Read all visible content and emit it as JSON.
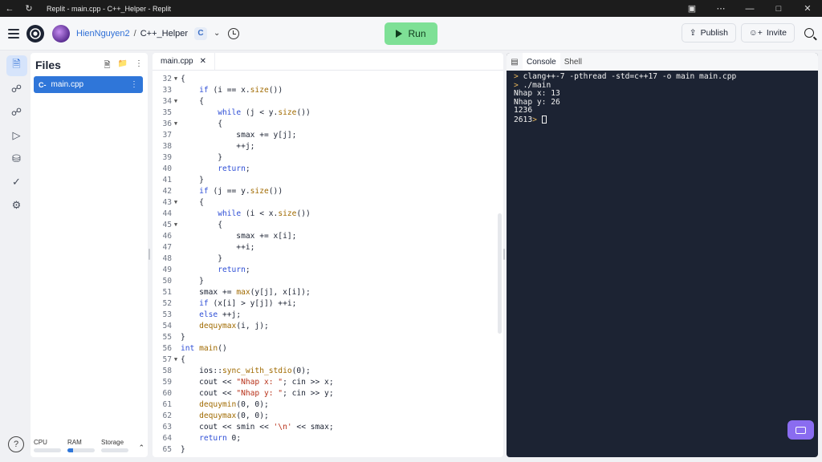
{
  "window": {
    "title": "Replit - main.cpp - C++_Helper - Replit"
  },
  "header": {
    "username": "HienNguyen2",
    "separator": "/",
    "repl_name": "C++_Helper",
    "lang_badge": "C",
    "run_label": "Run",
    "publish_label": "Publish",
    "invite_label": "Invite"
  },
  "files": {
    "title": "Files",
    "items": [
      {
        "label": "main.cpp",
        "icon_text": "C-"
      }
    ]
  },
  "resources": {
    "cpu": {
      "label": "CPU",
      "level": 0.0
    },
    "ram": {
      "label": "RAM",
      "level": 0.22
    },
    "storage": {
      "label": "Storage",
      "level": 0.0
    }
  },
  "editor": {
    "tab_label": "main.cpp",
    "lines": [
      {
        "n": "32",
        "fold": true,
        "t": [
          [
            "{",
            ""
          ]
        ]
      },
      {
        "n": "33",
        "fold": false,
        "t": [
          [
            "    ",
            ""
          ],
          [
            "if",
            "kw"
          ],
          [
            " (i == x.",
            ""
          ],
          [
            "size",
            "fnc"
          ],
          [
            "())",
            ""
          ]
        ]
      },
      {
        "n": "34",
        "fold": true,
        "t": [
          [
            "    {",
            ""
          ]
        ]
      },
      {
        "n": "35",
        "fold": false,
        "t": [
          [
            "        ",
            ""
          ],
          [
            "while",
            "kw"
          ],
          [
            " (j < y.",
            ""
          ],
          [
            "size",
            "fnc"
          ],
          [
            "())",
            ""
          ]
        ]
      },
      {
        "n": "36",
        "fold": true,
        "t": [
          [
            "        {",
            ""
          ]
        ]
      },
      {
        "n": "37",
        "fold": false,
        "t": [
          [
            "            smax += y[j];",
            ""
          ]
        ]
      },
      {
        "n": "38",
        "fold": false,
        "t": [
          [
            "            ++j;",
            ""
          ]
        ]
      },
      {
        "n": "39",
        "fold": false,
        "t": [
          [
            "        }",
            ""
          ]
        ]
      },
      {
        "n": "40",
        "fold": false,
        "t": [
          [
            "        ",
            ""
          ],
          [
            "return",
            "kw"
          ],
          [
            ";",
            ""
          ]
        ]
      },
      {
        "n": "41",
        "fold": false,
        "t": [
          [
            "    }",
            ""
          ]
        ]
      },
      {
        "n": "42",
        "fold": false,
        "t": [
          [
            "    ",
            ""
          ],
          [
            "if",
            "kw"
          ],
          [
            " (j == y.",
            ""
          ],
          [
            "size",
            "fnc"
          ],
          [
            "())",
            ""
          ]
        ]
      },
      {
        "n": "43",
        "fold": true,
        "t": [
          [
            "    {",
            ""
          ]
        ]
      },
      {
        "n": "44",
        "fold": false,
        "t": [
          [
            "        ",
            ""
          ],
          [
            "while",
            "kw"
          ],
          [
            " (i < x.",
            ""
          ],
          [
            "size",
            "fnc"
          ],
          [
            "())",
            ""
          ]
        ]
      },
      {
        "n": "45",
        "fold": true,
        "t": [
          [
            "        {",
            ""
          ]
        ]
      },
      {
        "n": "46",
        "fold": false,
        "t": [
          [
            "            smax += x[i];",
            ""
          ]
        ]
      },
      {
        "n": "47",
        "fold": false,
        "t": [
          [
            "            ++i;",
            ""
          ]
        ]
      },
      {
        "n": "48",
        "fold": false,
        "t": [
          [
            "        }",
            ""
          ]
        ]
      },
      {
        "n": "49",
        "fold": false,
        "t": [
          [
            "        ",
            ""
          ],
          [
            "return",
            "kw"
          ],
          [
            ";",
            ""
          ]
        ]
      },
      {
        "n": "50",
        "fold": false,
        "t": [
          [
            "    }",
            ""
          ]
        ]
      },
      {
        "n": "51",
        "fold": false,
        "t": [
          [
            "    smax += ",
            ""
          ],
          [
            "max",
            "fnc"
          ],
          [
            "(y[j], x[i]);",
            ""
          ]
        ]
      },
      {
        "n": "52",
        "fold": false,
        "t": [
          [
            "    ",
            ""
          ],
          [
            "if",
            "kw"
          ],
          [
            " (x[i] > y[j]) ++i;",
            ""
          ]
        ]
      },
      {
        "n": "53",
        "fold": false,
        "t": [
          [
            "    ",
            ""
          ],
          [
            "else",
            "kw"
          ],
          [
            " ++j;",
            ""
          ]
        ]
      },
      {
        "n": "54",
        "fold": false,
        "t": [
          [
            "    ",
            ""
          ],
          [
            "dequymax",
            "fnc"
          ],
          [
            "(i, j);",
            ""
          ]
        ]
      },
      {
        "n": "55",
        "fold": false,
        "t": [
          [
            "}",
            ""
          ]
        ]
      },
      {
        "n": "56",
        "fold": false,
        "t": [
          [
            "int",
            "kw"
          ],
          [
            " ",
            ""
          ],
          [
            "main",
            "fnc"
          ],
          [
            "()",
            ""
          ]
        ]
      },
      {
        "n": "57",
        "fold": true,
        "t": [
          [
            "{",
            ""
          ]
        ]
      },
      {
        "n": "58",
        "fold": false,
        "t": [
          [
            "    ios::",
            ""
          ],
          [
            "sync_with_stdio",
            "fnc"
          ],
          [
            "(",
            ""
          ],
          [
            "0",
            ""
          ],
          [
            ");",
            ""
          ]
        ]
      },
      {
        "n": "59",
        "fold": false,
        "t": [
          [
            "    cout << ",
            ""
          ],
          [
            "\"Nhap x: \"",
            "str"
          ],
          [
            "; cin >> x;",
            ""
          ]
        ]
      },
      {
        "n": "60",
        "fold": false,
        "t": [
          [
            "    cout << ",
            ""
          ],
          [
            "\"Nhap y: \"",
            "str"
          ],
          [
            "; cin >> y;",
            ""
          ]
        ]
      },
      {
        "n": "61",
        "fold": false,
        "t": [
          [
            "    ",
            ""
          ],
          [
            "dequymin",
            "fnc"
          ],
          [
            "(0, 0);",
            ""
          ]
        ]
      },
      {
        "n": "62",
        "fold": false,
        "t": [
          [
            "    ",
            ""
          ],
          [
            "dequymax",
            "fnc"
          ],
          [
            "(0, 0);",
            ""
          ]
        ]
      },
      {
        "n": "63",
        "fold": false,
        "t": [
          [
            "    cout << smin << ",
            ""
          ],
          [
            "'\\n'",
            "str"
          ],
          [
            " << smax;",
            ""
          ]
        ]
      },
      {
        "n": "64",
        "fold": false,
        "t": [
          [
            "    ",
            ""
          ],
          [
            "return",
            "kw"
          ],
          [
            " 0;",
            ""
          ]
        ]
      },
      {
        "n": "65",
        "fold": false,
        "t": [
          [
            "}",
            ""
          ]
        ]
      }
    ]
  },
  "console": {
    "tabs": [
      "Console",
      "Shell"
    ],
    "lines": [
      {
        "prompt": "> ",
        "text": "clang++-7 -pthread -std=c++17 -o main main.cpp"
      },
      {
        "prompt": "> ",
        "text": "./main"
      },
      {
        "prompt": "",
        "text": "Nhap x: 13"
      },
      {
        "prompt": "",
        "text": "Nhap y: 26"
      },
      {
        "prompt": "",
        "text": "1236"
      }
    ],
    "last_output": "2613",
    "last_prompt": "> "
  }
}
